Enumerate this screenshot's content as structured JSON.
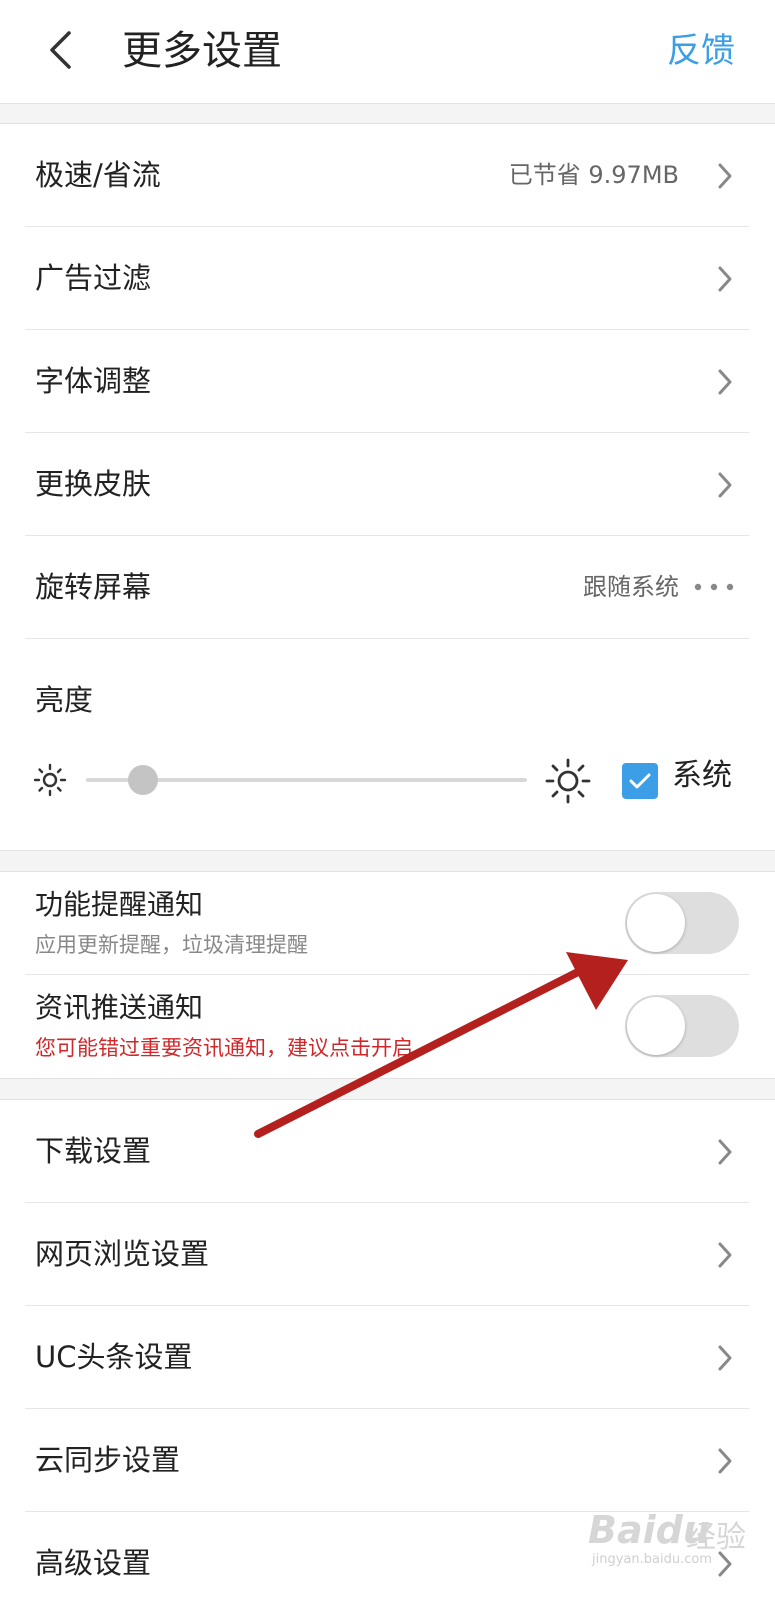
{
  "header": {
    "title": "更多设置",
    "feedback": "反馈"
  },
  "rows_top": [
    {
      "label": "极速/省流",
      "value": "已节省 9.97MB",
      "trail": "chevron"
    },
    {
      "label": "广告过滤",
      "value": "",
      "trail": "chevron"
    },
    {
      "label": "字体调整",
      "value": "",
      "trail": "chevron"
    },
    {
      "label": "更换皮肤",
      "value": "",
      "trail": "chevron"
    },
    {
      "label": "旋转屏幕",
      "value": "跟随系统",
      "trail": "dots"
    }
  ],
  "brightness": {
    "label": "亮度",
    "level": 0.13,
    "system_checked": true,
    "system_label": "系统"
  },
  "notifications": [
    {
      "title": "功能提醒通知",
      "subtitle": "应用更新提醒，垃圾清理提醒",
      "subtitle_warn": false,
      "enabled": false
    },
    {
      "title": "资讯推送通知",
      "subtitle": "您可能错过重要资讯通知，建议点击开启",
      "subtitle_warn": true,
      "enabled": false
    }
  ],
  "rows_bottom": [
    {
      "label": "下载设置"
    },
    {
      "label": "网页浏览设置"
    },
    {
      "label": "UC头条设置"
    },
    {
      "label": "云同步设置"
    },
    {
      "label": "高级设置"
    }
  ],
  "watermark": {
    "logo": "Baidu",
    "cn": "经验",
    "url": "jingyan.baidu.com"
  },
  "colors": {
    "accent": "#3b9ee6",
    "warning": "#d0282a",
    "annotation_arrow": "#b3201d"
  }
}
